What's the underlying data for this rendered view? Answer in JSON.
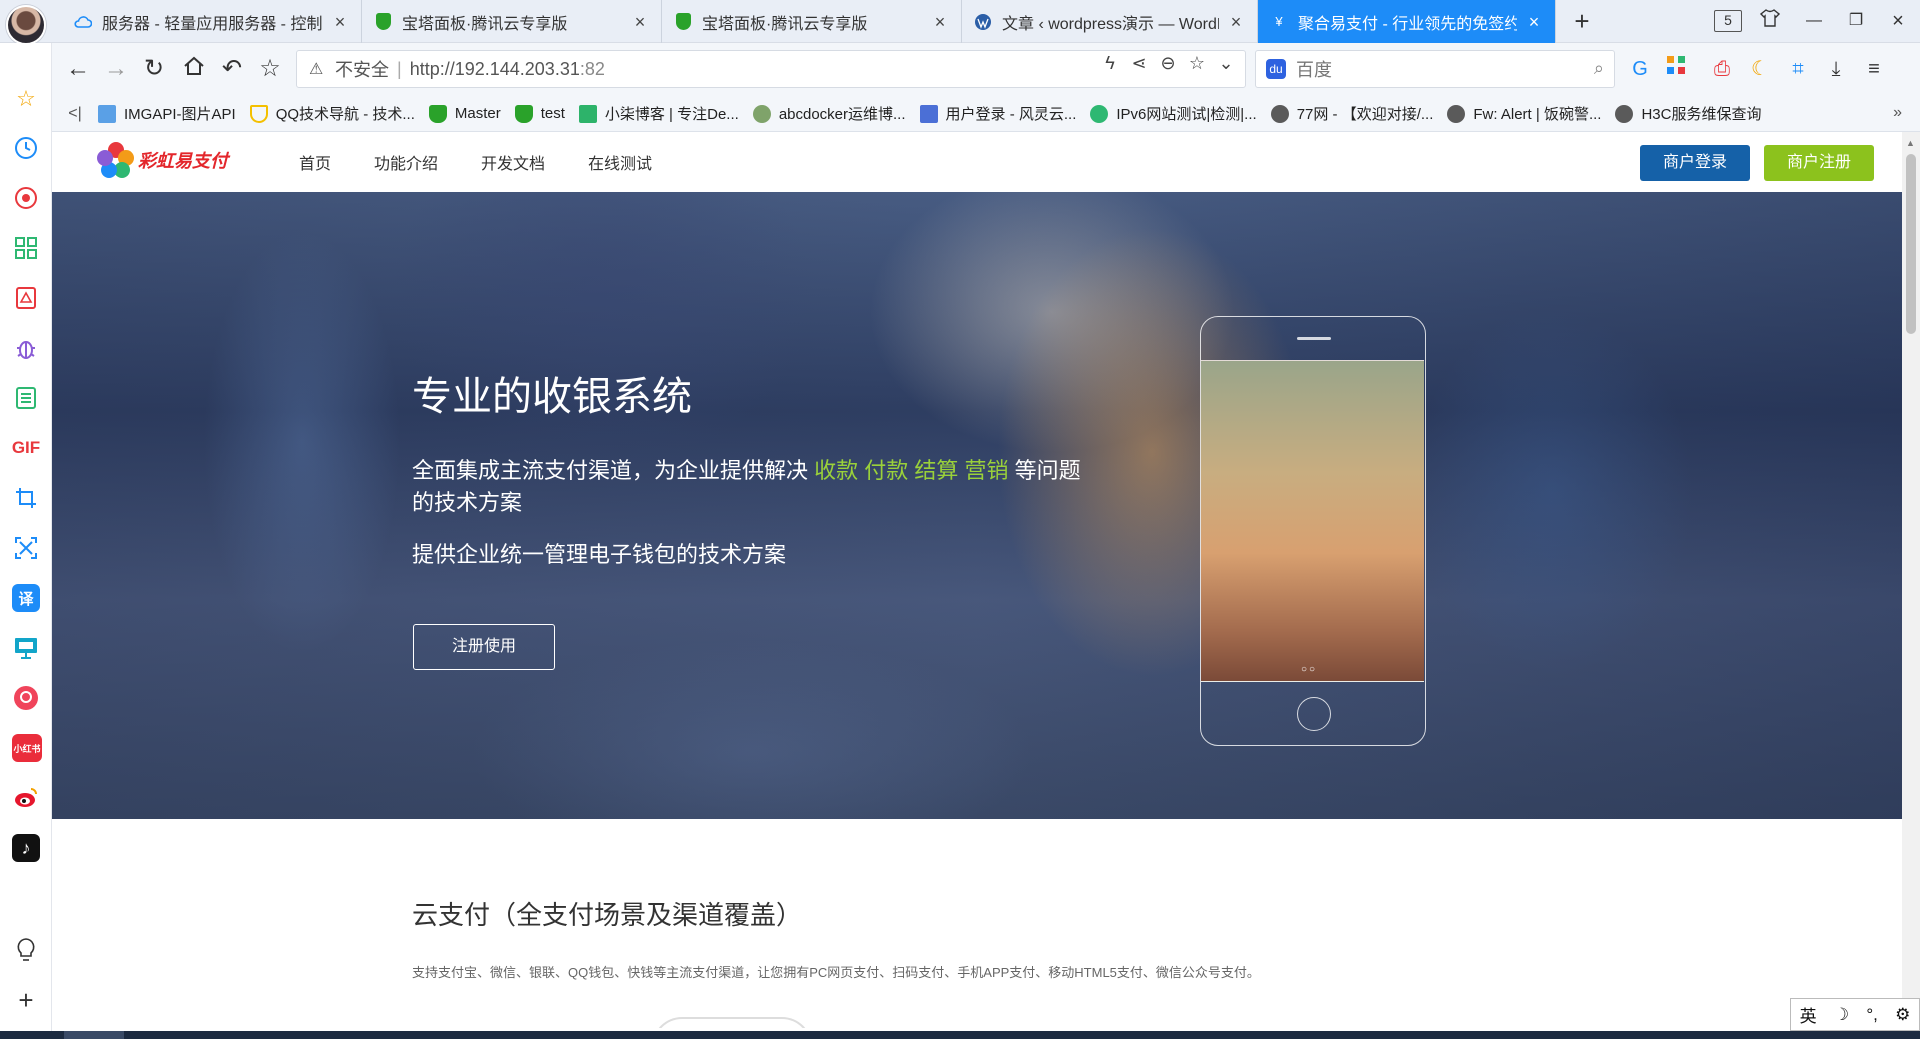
{
  "browser": {
    "tabs": [
      {
        "title": "服务器 - 轻量应用服务器 - 控制台",
        "icon": "cloud-icon",
        "active": false
      },
      {
        "title": "宝塔面板·腾讯云专享版",
        "icon": "shield-icon",
        "active": false
      },
      {
        "title": "宝塔面板·腾讯云专享版",
        "icon": "shield-icon",
        "active": false
      },
      {
        "title": "文章 ‹ wordpress演示 — WordPress",
        "icon": "wordpress-icon",
        "active": false
      },
      {
        "title": "聚合易支付 - 行业领先的免签约支付平台",
        "icon": "yen-icon",
        "active": true
      }
    ],
    "tab_count": "5",
    "address": {
      "insecure_label": "不安全",
      "url_host": "http://192.144.203.31",
      "url_port": ":82"
    },
    "search": {
      "placeholder": "百度"
    },
    "bookmarks": [
      "IMGAPI-图片API",
      "QQ技术导航 - 技术...",
      "Master",
      "test",
      "小柒博客 | 专注De...",
      "abcdocker运维博...",
      "用户登录 - 风灵云...",
      "IPv6网站测试|检测|...",
      "77网 - 【欢迎对接/...",
      "Fw: Alert | 饭碗警...",
      "H3C服务维保查询"
    ],
    "bookmark_back": "<|",
    "bookmark_more": "»"
  },
  "site": {
    "logo_text": "彩虹易支付",
    "nav": [
      "首页",
      "功能介绍",
      "开发文档",
      "在线测试"
    ],
    "login_label": "商户登录",
    "register_label": "商户注册",
    "hero": {
      "title": "专业的收银系统",
      "line1_prefix": "全面集成主流支付渠道，为企业提供解决 ",
      "line1_highlight": "收款 付款 结算 营销",
      "line1_suffix": " 等问题的技术方案",
      "line2": "提供企业统一管理电子钱包的技术方案",
      "cta_label": "注册使用",
      "phone_dots": "○○"
    },
    "section": {
      "title": "云支付（全支付场景及渠道覆盖）",
      "desc": "支持支付宝、微信、银联、QQ钱包、快钱等主流支付渠道，让您拥有PC网页支付、扫码支付、手机APP支付、移动HTML5支付、微信公众号支付。"
    }
  },
  "ime": {
    "lang": "英",
    "moon": "☽",
    "punct": "°,",
    "gear": "⚙"
  }
}
